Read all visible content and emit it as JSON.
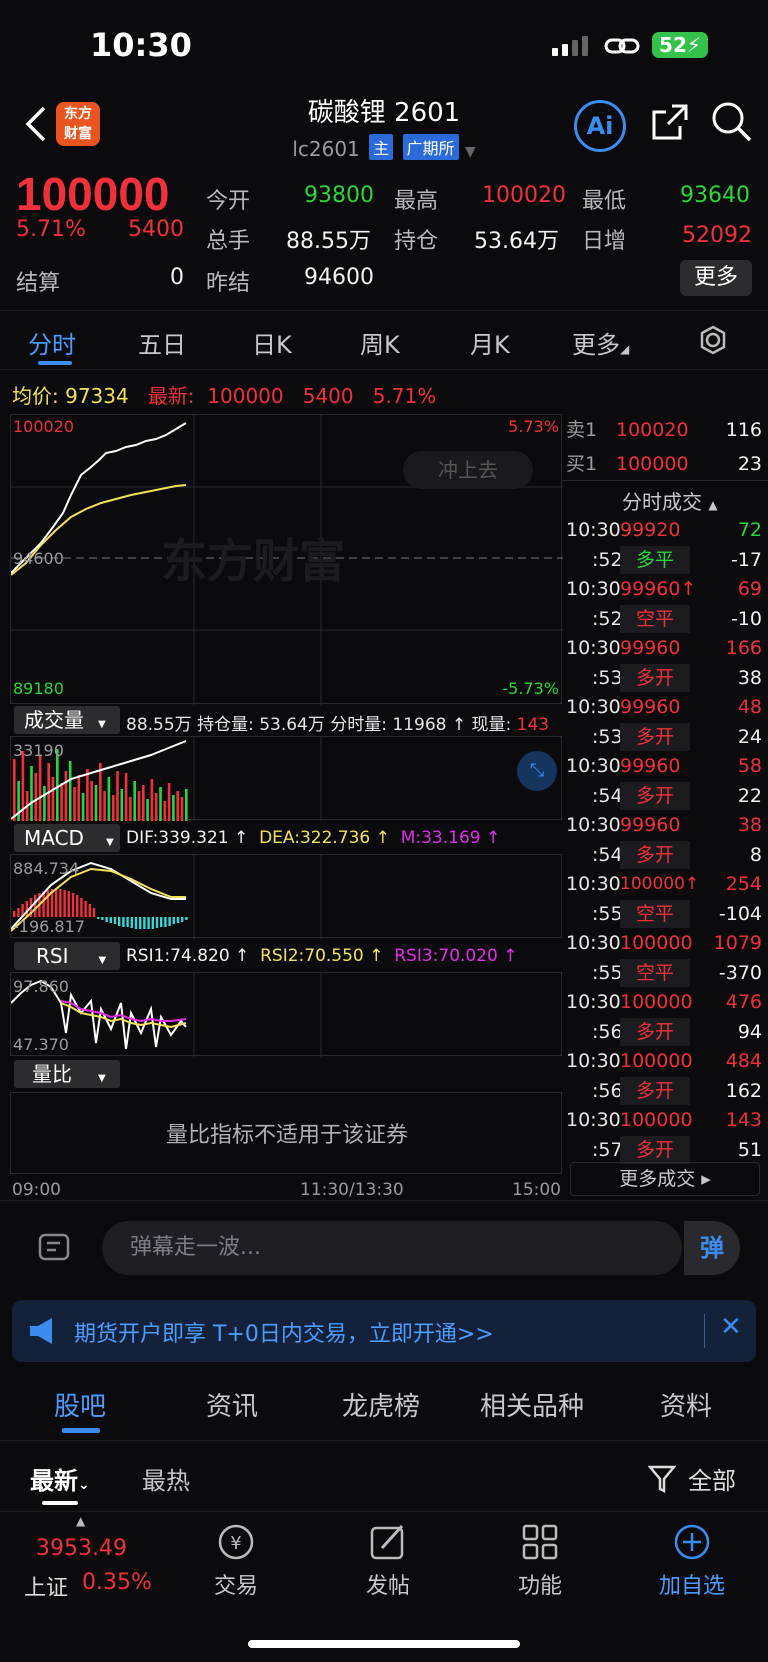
{
  "status_bar": {
    "time": "10:30",
    "battery": "52"
  },
  "header": {
    "logo_line1": "东方",
    "logo_line2": "财富",
    "title": "碳酸锂 2601",
    "code": "lc2601",
    "tag_main": "主",
    "tag_exchange": "广期所",
    "ai_label": "Ai"
  },
  "quote": {
    "price": "100000",
    "change_pct": "5.71%",
    "change": "5400",
    "settle_label": "结算",
    "settle_value": "0",
    "open_label": "今开",
    "open_value": "93800",
    "high_label": "最高",
    "high_value": "100020",
    "low_label": "最低",
    "low_value": "93640",
    "vol_label": "总手",
    "vol_value": "88.55万",
    "oi_label": "持仓",
    "oi_value": "53.64万",
    "daily_inc_label": "日增",
    "daily_inc_value": "52092",
    "prev_settle_label": "昨结",
    "prev_settle_value": "94600",
    "more_label": "更多"
  },
  "chart_tabs": [
    "分时",
    "五日",
    "日K",
    "周K",
    "月K",
    "更多"
  ],
  "info_line": {
    "avg_label": "均价:",
    "avg_value": "97334",
    "last_label": "最新:",
    "last_value": "100000",
    "last_change": "5400",
    "last_pct": "5.71%"
  },
  "price_panel": {
    "top_price": "100020",
    "top_pct": "5.73%",
    "mid_price": "94600",
    "bottom_price": "89180",
    "bottom_pct": "-5.73%",
    "hint": "冲上去",
    "watermark": "东方财富"
  },
  "volume_panel": {
    "label": "成交量",
    "stats": "88.55万 持仓量: 53.64万 分时量: 11968 ↑ 现量:",
    "current": "143",
    "max_label": "33190"
  },
  "macd_panel": {
    "label": "MACD",
    "dif": "DIF:339.321 ↑",
    "dea": "DEA:322.736 ↑",
    "m": "M:33.169 ↑",
    "max_label": "884.734",
    "min_label": "-196.817"
  },
  "rsi_panel": {
    "label": "RSI",
    "rsi1": "RSI1:74.820 ↑",
    "rsi2": "RSI2:70.550 ↑",
    "rsi3": "RSI3:70.020 ↑",
    "max_label": "97.860",
    "min_label": "47.370"
  },
  "ratio_panel": {
    "label": "量比",
    "message": "量比指标不适用于该证券"
  },
  "time_axis": {
    "start": "09:00",
    "mid": "11:30/13:30",
    "end": "15:00"
  },
  "order_book": {
    "sell_label": "卖1",
    "sell_price": "100020",
    "sell_vol": "116",
    "buy_label": "买1",
    "buy_price": "100000",
    "buy_vol": "23",
    "ticks_header": "分时成交",
    "more_ticks": "更多成交"
  },
  "ticks": [
    {
      "time": "10:30",
      "price": "99920",
      "vol": "72",
      "volColor": "green"
    },
    {
      "time": ":52",
      "type": "多平",
      "typeColor": "green",
      "vol": "-17"
    },
    {
      "time": "10:30",
      "price": "99960↑",
      "vol": "69",
      "volColor": "red"
    },
    {
      "time": ":52",
      "type": "空平",
      "typeColor": "red",
      "vol": "-10"
    },
    {
      "time": "10:30",
      "price": "99960",
      "vol": "166",
      "volColor": "red"
    },
    {
      "time": ":53",
      "type": "多开",
      "typeColor": "red",
      "vol": "38"
    },
    {
      "time": "10:30",
      "price": "99960",
      "vol": "48",
      "volColor": "red"
    },
    {
      "time": ":53",
      "type": "多开",
      "typeColor": "red",
      "vol": "24"
    },
    {
      "time": "10:30",
      "price": "99960",
      "vol": "58",
      "volColor": "red"
    },
    {
      "time": ":54",
      "type": "多开",
      "typeColor": "red",
      "vol": "22"
    },
    {
      "time": "10:30",
      "price": "99960",
      "vol": "38",
      "volColor": "red"
    },
    {
      "time": ":54",
      "type": "多开",
      "typeColor": "red",
      "vol": "8"
    },
    {
      "time": "10:30",
      "price": "100000↑",
      "vol": "254",
      "volColor": "red"
    },
    {
      "time": ":55",
      "type": "空平",
      "typeColor": "red",
      "vol": "-104"
    },
    {
      "time": "10:30",
      "price": "100000",
      "vol": "1079",
      "volColor": "red"
    },
    {
      "time": ":55",
      "type": "空平",
      "typeColor": "red",
      "vol": "-370"
    },
    {
      "time": "10:30",
      "price": "100000",
      "vol": "476",
      "volColor": "red"
    },
    {
      "time": ":56",
      "type": "多开",
      "typeColor": "red",
      "vol": "94"
    },
    {
      "time": "10:30",
      "price": "100000",
      "vol": "484",
      "volColor": "red"
    },
    {
      "time": ":56",
      "type": "多开",
      "typeColor": "red",
      "vol": "162"
    },
    {
      "time": "10:30",
      "price": "100000",
      "vol": "143",
      "volColor": "red"
    },
    {
      "time": ":57",
      "type": "多开",
      "typeColor": "red",
      "vol": "51"
    }
  ],
  "danmaku": {
    "placeholder": "弹幕走一波...",
    "button": "弹"
  },
  "banner": {
    "text": "期货开户即享 T+0日内交易，立即开通>>"
  },
  "bottom_tabs": [
    "股吧",
    "资讯",
    "龙虎榜",
    "相关品种",
    "资料"
  ],
  "sub_tabs": {
    "latest": "最新",
    "hot": "最热",
    "filter": "全部"
  },
  "nav": {
    "index_value": "3953.49",
    "index_name": "上证",
    "index_pct": "0.35%",
    "trade": "交易",
    "post": "发帖",
    "functions": "功能",
    "add_watch": "加自选"
  },
  "colors": {
    "up": "#f0303a",
    "down": "#2bd63a",
    "accent": "#3c8cf0",
    "avg_line": "#f2e25a"
  }
}
